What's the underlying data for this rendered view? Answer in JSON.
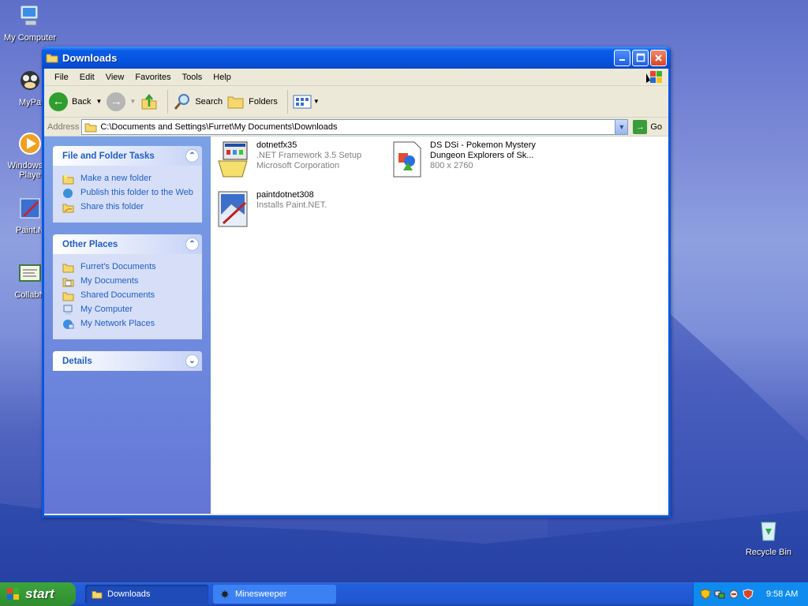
{
  "desktop": {
    "icons": [
      {
        "label": "My Computer"
      },
      {
        "label": "MyPa"
      },
      {
        "label": "Windows M Playe"
      },
      {
        "label": "Paint.N"
      },
      {
        "label": "CollabN"
      },
      {
        "label": "Recycle Bin"
      }
    ]
  },
  "window": {
    "title": "Downloads",
    "menu": [
      "File",
      "Edit",
      "View",
      "Favorites",
      "Tools",
      "Help"
    ],
    "toolbar": {
      "back": "Back",
      "search": "Search",
      "folders": "Folders"
    },
    "address": {
      "label": "Address",
      "value": "C:\\Documents and Settings\\Furret\\My Documents\\Downloads",
      "go": "Go"
    },
    "taskpane": {
      "tasks": {
        "title": "File and Folder Tasks",
        "items": [
          "Make a new folder",
          "Publish this folder to the Web",
          "Share this folder"
        ]
      },
      "places": {
        "title": "Other Places",
        "items": [
          "Furret's Documents",
          "My Documents",
          "Shared Documents",
          "My Computer",
          "My Network Places"
        ]
      },
      "details": {
        "title": "Details"
      }
    },
    "files": [
      {
        "name": "dotnetfx35",
        "line2": ".NET Framework 3.5 Setup",
        "line3": "Microsoft Corporation"
      },
      {
        "name": "DS DSi - Pokemon Mystery",
        "line2": "Dungeon Explorers of Sk...",
        "line3": "800 x 2760"
      },
      {
        "name": "paintdotnet308",
        "line2": "Installs Paint.NET.",
        "line3": ""
      }
    ]
  },
  "taskbar": {
    "start": "start",
    "tasks": [
      {
        "label": "Downloads"
      },
      {
        "label": "Minesweeper"
      }
    ],
    "clock": "9:58 AM"
  }
}
